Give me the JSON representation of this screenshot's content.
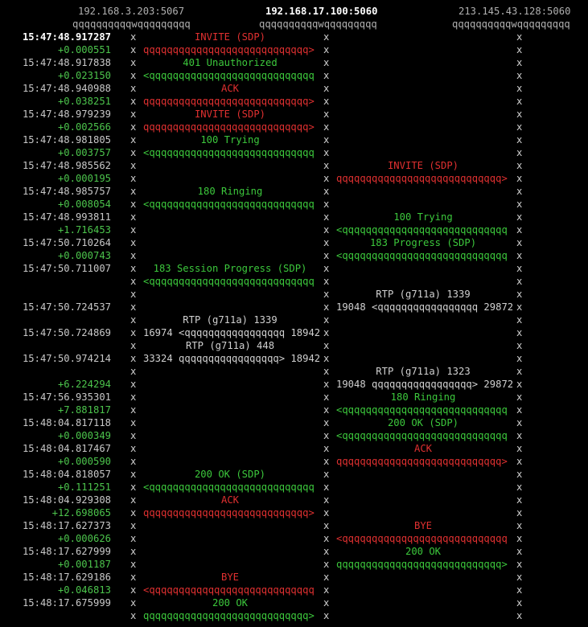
{
  "header": {
    "hosts": [
      "192.168.3.203:5067",
      "192.168.17.100:5060",
      "213.145.43.128:5060"
    ],
    "bars": [
      "qqqqqqqqqqwqqqqqqqqq",
      "qqqqqqqqqqwqqqqqqqqq",
      "qqqqqqqqqqwqqqqqqqqq"
    ]
  },
  "colors": {
    "request": "#e03030",
    "response": "#3cc83c",
    "rtp": "#d0d0d0",
    "delta": "#4cc44c"
  },
  "rows": [
    {
      "t": "15:47:48.917287",
      "bold": true,
      "label": "INVITE (SDP)",
      "seg": "L",
      "color": "red"
    },
    {
      "t": "+0.000551",
      "delta": true,
      "arrow": "qqqqqqqqqqqqqqqqqqqqqqqqqqqq>",
      "seg": "L",
      "color": "red"
    },
    {
      "t": "15:47:48.917838",
      "label": "401 Unauthorized",
      "seg": "L",
      "color": "green"
    },
    {
      "t": "+0.023150",
      "delta": true,
      "arrow": "<qqqqqqqqqqqqqqqqqqqqqqqqqqqq",
      "seg": "L",
      "color": "green"
    },
    {
      "t": "15:47:48.940988",
      "label": "ACK",
      "seg": "L",
      "color": "red"
    },
    {
      "t": "+0.038251",
      "delta": true,
      "arrow": "qqqqqqqqqqqqqqqqqqqqqqqqqqqq>",
      "seg": "L",
      "color": "red"
    },
    {
      "t": "15:47:48.979239",
      "label": "INVITE (SDP)",
      "seg": "L",
      "color": "red"
    },
    {
      "t": "+0.002566",
      "delta": true,
      "arrow": "qqqqqqqqqqqqqqqqqqqqqqqqqqqq>",
      "seg": "L",
      "color": "red"
    },
    {
      "t": "15:47:48.981805",
      "label": "100 Trying",
      "seg": "L",
      "color": "green"
    },
    {
      "t": "+0.003757",
      "delta": true,
      "arrow": "<qqqqqqqqqqqqqqqqqqqqqqqqqqqq",
      "seg": "L",
      "color": "green"
    },
    {
      "t": "15:47:48.985562",
      "label": "INVITE (SDP)",
      "seg": "R",
      "color": "red"
    },
    {
      "t": "+0.000195",
      "delta": true,
      "arrow": "qqqqqqqqqqqqqqqqqqqqqqqqqqqq>",
      "seg": "R",
      "color": "red"
    },
    {
      "t": "15:47:48.985757",
      "label": "180 Ringing",
      "seg": "L",
      "color": "green"
    },
    {
      "t": "+0.008054",
      "delta": true,
      "arrow": "<qqqqqqqqqqqqqqqqqqqqqqqqqqqq",
      "seg": "L",
      "color": "green"
    },
    {
      "t": "15:47:48.993811",
      "label": "100 Trying",
      "seg": "R",
      "color": "green"
    },
    {
      "t": "+1.716453",
      "delta": true,
      "arrow": "<qqqqqqqqqqqqqqqqqqqqqqqqqqqq",
      "seg": "R",
      "color": "green"
    },
    {
      "t": "15:47:50.710264",
      "label": "183 Progress (SDP)",
      "seg": "R",
      "color": "green"
    },
    {
      "t": "+0.000743",
      "delta": true,
      "arrow": "<qqqqqqqqqqqqqqqqqqqqqqqqqqqq",
      "seg": "R",
      "color": "green"
    },
    {
      "t": "15:47:50.711007",
      "label": "183 Session Progress (SDP)",
      "seg": "L",
      "color": "green"
    },
    {
      "t": "",
      "arrow": "<qqqqqqqqqqqqqqqqqqqqqqqqqqqq",
      "seg": "L",
      "color": "green"
    },
    {
      "t": "",
      "label": "RTP (g711a) 1339",
      "seg": "R",
      "color": "white"
    },
    {
      "t": "15:47:50.724537",
      "arrow": "19048 <qqqqqqqqqqqqqqqqq 29872",
      "seg": "R",
      "color": "white"
    },
    {
      "t": "",
      "label": "RTP (g711a) 1339",
      "seg": "L",
      "color": "white"
    },
    {
      "t": "15:47:50.724869",
      "arrow": "16974 <qqqqqqqqqqqqqqqqq 18942",
      "seg": "L",
      "color": "white"
    },
    {
      "t": "",
      "label": "RTP (g711a) 448",
      "seg": "L",
      "color": "white"
    },
    {
      "t": "15:47:50.974214",
      "arrow": "33324 qqqqqqqqqqqqqqqqq> 18942",
      "seg": "L",
      "color": "white"
    },
    {
      "t": "",
      "label": "RTP (g711a) 1323",
      "seg": "R",
      "color": "white"
    },
    {
      "t": "+6.224294",
      "delta": true,
      "arrow": "19048 qqqqqqqqqqqqqqqqq> 29872",
      "seg": "R",
      "color": "white"
    },
    {
      "t": "15:47:56.935301",
      "label": "180 Ringing",
      "seg": "R",
      "color": "green"
    },
    {
      "t": "+7.881817",
      "delta": true,
      "arrow": "<qqqqqqqqqqqqqqqqqqqqqqqqqqqq",
      "seg": "R",
      "color": "green"
    },
    {
      "t": "15:48:04.817118",
      "label": "200 OK (SDP)",
      "seg": "R",
      "color": "green"
    },
    {
      "t": "+0.000349",
      "delta": true,
      "arrow": "<qqqqqqqqqqqqqqqqqqqqqqqqqqqq",
      "seg": "R",
      "color": "green"
    },
    {
      "t": "15:48:04.817467",
      "label": "ACK",
      "seg": "R",
      "color": "red"
    },
    {
      "t": "+0.000590",
      "delta": true,
      "arrow": "qqqqqqqqqqqqqqqqqqqqqqqqqqqq>",
      "seg": "R",
      "color": "red"
    },
    {
      "t": "15:48:04.818057",
      "label": "200 OK (SDP)",
      "seg": "L",
      "color": "green"
    },
    {
      "t": "+0.111251",
      "delta": true,
      "arrow": "<qqqqqqqqqqqqqqqqqqqqqqqqqqqq",
      "seg": "L",
      "color": "green"
    },
    {
      "t": "15:48:04.929308",
      "label": "ACK",
      "seg": "L",
      "color": "red"
    },
    {
      "t": "+12.698065",
      "delta": true,
      "arrow": "qqqqqqqqqqqqqqqqqqqqqqqqqqqq>",
      "seg": "L",
      "color": "red"
    },
    {
      "t": "15:48:17.627373",
      "label": "BYE",
      "seg": "R",
      "color": "red"
    },
    {
      "t": "+0.000626",
      "delta": true,
      "arrow": "<qqqqqqqqqqqqqqqqqqqqqqqqqqqq",
      "seg": "R",
      "color": "red"
    },
    {
      "t": "15:48:17.627999",
      "label": "200 OK",
      "seg": "R",
      "color": "green"
    },
    {
      "t": "+0.001187",
      "delta": true,
      "arrow": "qqqqqqqqqqqqqqqqqqqqqqqqqqqq>",
      "seg": "R",
      "color": "green"
    },
    {
      "t": "15:48:17.629186",
      "label": "BYE",
      "seg": "L",
      "color": "red"
    },
    {
      "t": "+0.046813",
      "delta": true,
      "arrow": "<qqqqqqqqqqqqqqqqqqqqqqqqqqqq",
      "seg": "L",
      "color": "red"
    },
    {
      "t": "15:48:17.675999",
      "label": "200 OK",
      "seg": "L",
      "color": "green"
    },
    {
      "t": "",
      "arrow": "qqqqqqqqqqqqqqqqqqqqqqqqqqqq>",
      "seg": "L",
      "color": "green"
    }
  ]
}
